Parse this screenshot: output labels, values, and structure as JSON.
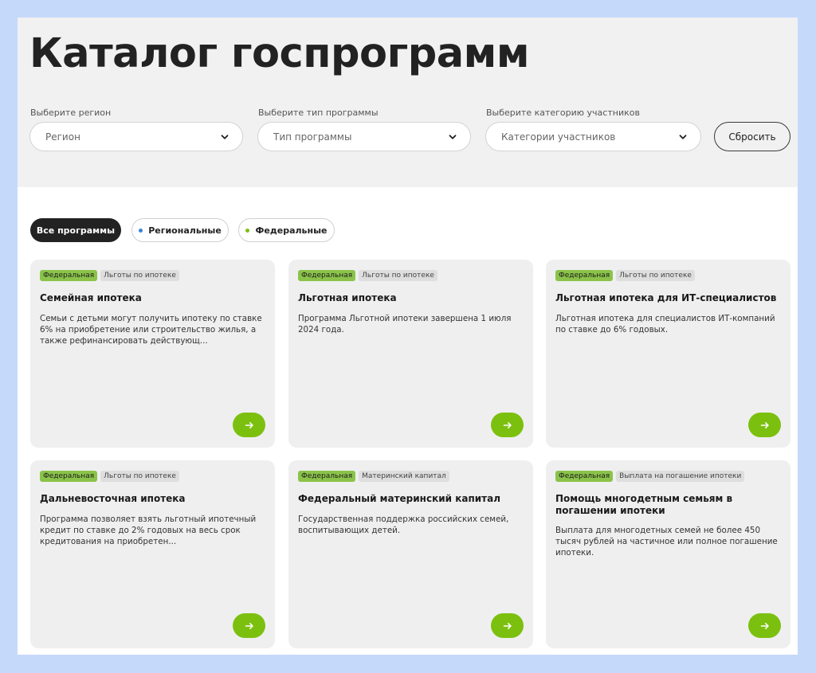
{
  "page": {
    "title": "Каталог госпрограмм"
  },
  "filters": {
    "region": {
      "label": "Выберите регион",
      "placeholder": "Регион"
    },
    "type": {
      "label": "Выберите тип программы",
      "placeholder": "Тип программы"
    },
    "category": {
      "label": "Выберите категорию участников",
      "placeholder": "Категории участников"
    },
    "reset_label": "Сбросить"
  },
  "tabs": [
    {
      "label": "Все программы",
      "active": true
    },
    {
      "label": "Региональные",
      "dot_color": "#3b82d6"
    },
    {
      "label": "Федеральные",
      "dot_color": "#7cc00f"
    }
  ],
  "colors": {
    "accent": "#7cc00f",
    "tag_federal": "#8bc34a",
    "tag_category": "#dedede",
    "card_bg": "#efefef"
  },
  "icons": {
    "select_arrow": "chevron-down-icon",
    "card_button": "arrow-right-icon"
  },
  "cards": [
    {
      "tag_level": "Федеральная",
      "tag_category": "Льготы по ипотеке",
      "title": "Семейная ипотека",
      "description": "Семьи с детьми могут получить ипотеку по ставке 6% на приобретение или строительство жилья, а также рефинансировать действующ..."
    },
    {
      "tag_level": "Федеральная",
      "tag_category": "Льготы по ипотеке",
      "title": "Льготная ипотека",
      "description": "Программа Льготной ипотеки завершена 1 июля 2024 года."
    },
    {
      "tag_level": "Федеральная",
      "tag_category": "Льготы по ипотеке",
      "title": "Льготная ипотека для ИТ-специалистов",
      "description": "Льготная ипотека для специалистов ИТ-компаний по ставке до 6% годовых."
    },
    {
      "tag_level": "Федеральная",
      "tag_category": "Льготы по ипотеке",
      "title": "Дальневосточная ипотека",
      "description": "Программа позволяет взять льготный ипотечный кредит по ставке до 2% годовых на весь срок кредитования на приобретен..."
    },
    {
      "tag_level": "Федеральная",
      "tag_category": "Материнский капитал",
      "title": "Федеральный материнский капитал",
      "description": "Государственная поддержка российских семей, воспитывающих детей."
    },
    {
      "tag_level": "Федеральная",
      "tag_category": "Выплата на погашение ипотеки",
      "title": "Помощь многодетным семьям в погашении ипотеки",
      "description": "Выплата для многодетных семей не более 450 тысяч рублей на частичное или полное погашение ипотеки."
    }
  ]
}
